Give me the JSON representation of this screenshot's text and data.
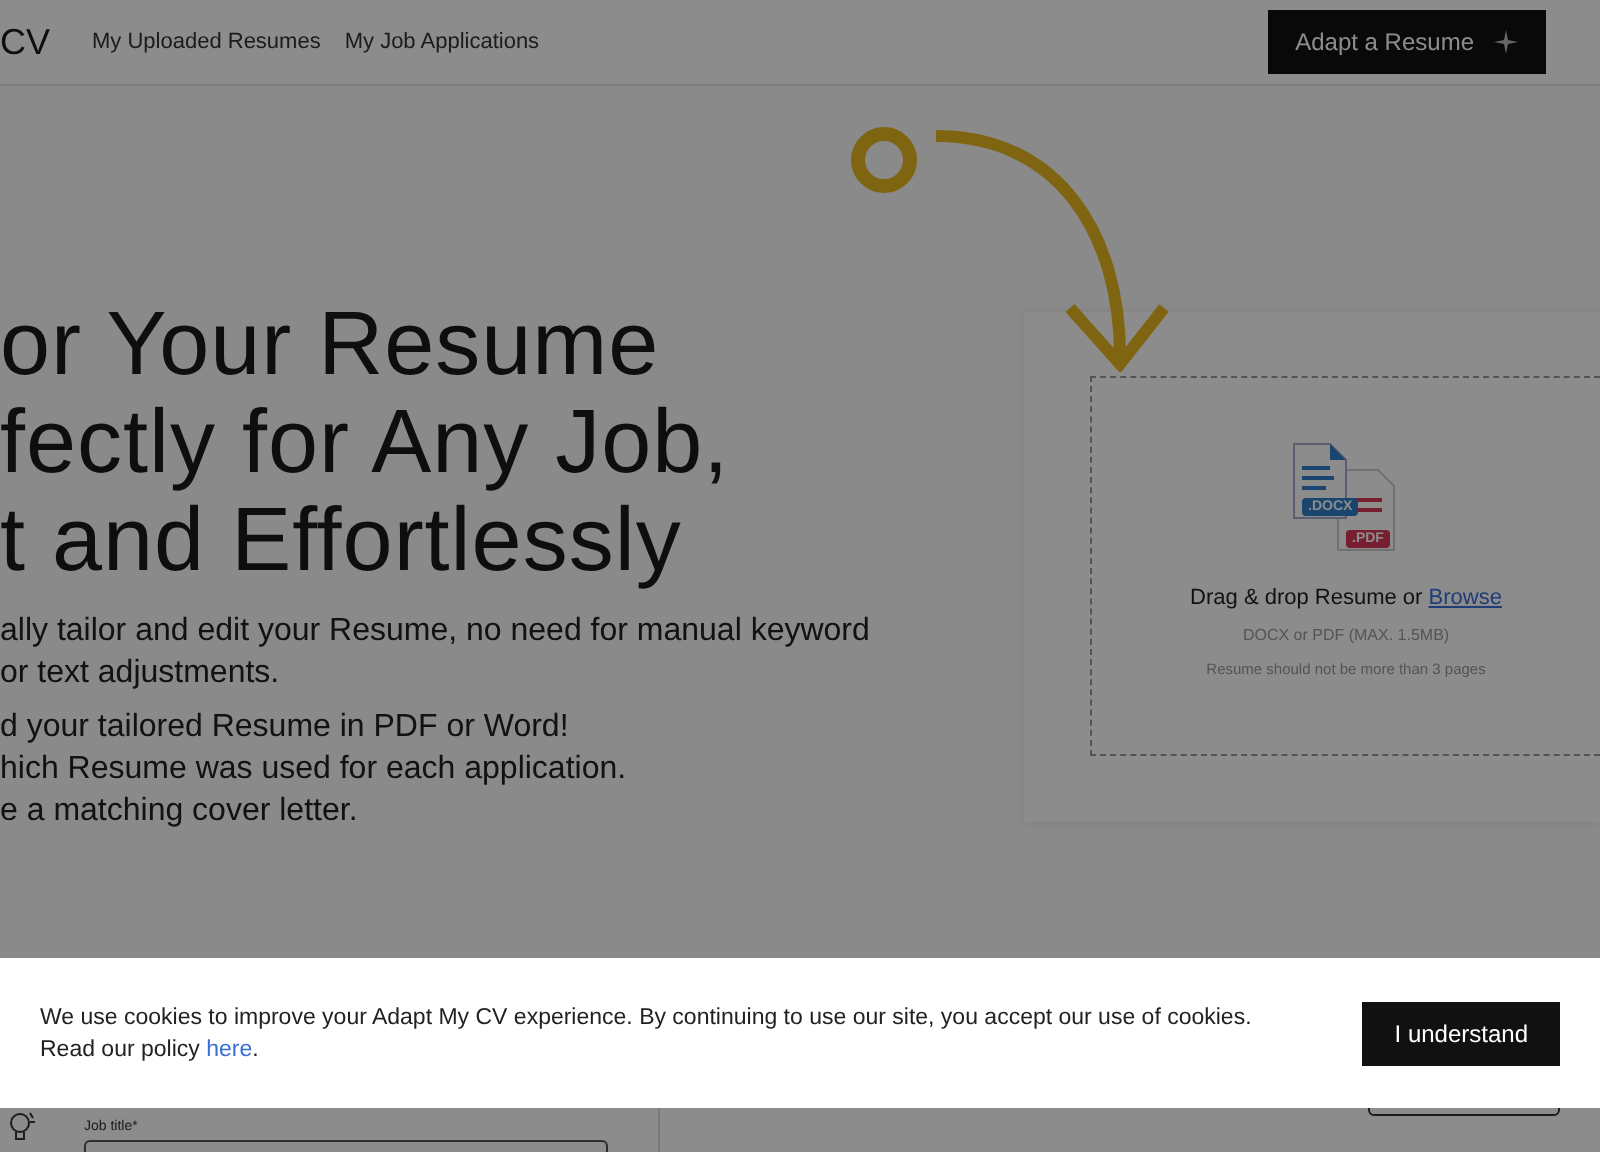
{
  "header": {
    "logo": "CV",
    "nav": [
      {
        "label": "My Uploaded Resumes"
      },
      {
        "label": "My Job Applications"
      }
    ],
    "cta": "Adapt a Resume"
  },
  "hero": {
    "heading_lines": [
      "or Your Resume",
      "fectly for Any Job,",
      "t and Effortlessly"
    ],
    "paragraphs": [
      [
        "ally tailor and edit your Resume, no need for manual keyword",
        "or text adjustments."
      ],
      [
        "d your tailored Resume in PDF or Word!",
        "hich Resume was used for each application.",
        "e a matching cover letter."
      ]
    ]
  },
  "upload": {
    "file_badges": [
      ".DOCX",
      ".PDF"
    ],
    "prompt": "Drag & drop Resume or ",
    "link": "Browse",
    "formats": "DOCX or PDF (MAX. 1.5MB)",
    "note": "Resume should not be more than 3 pages"
  },
  "form": {
    "job_title_label": "Job title*"
  },
  "cookie_banner": {
    "message": "We use cookies to improve your Adapt My CV experience. By continuing to use our site, you accept our use of cookies. Read our policy ",
    "link": "here",
    "after_link": ".",
    "button": "I understand"
  }
}
